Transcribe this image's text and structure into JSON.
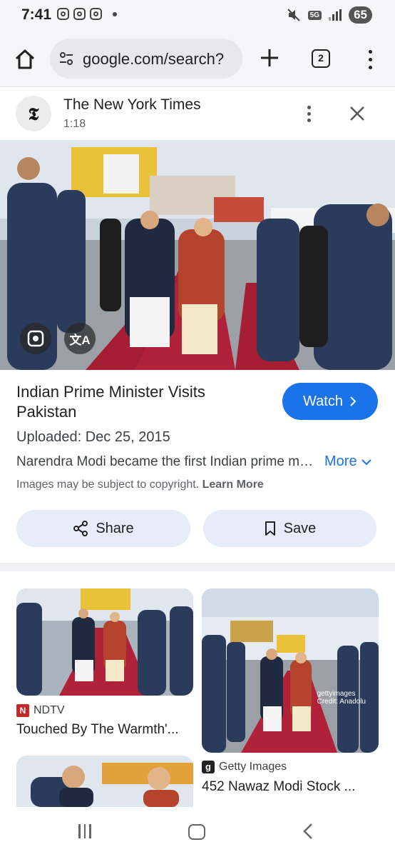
{
  "status_bar": {
    "time": "7:41",
    "network": "5G",
    "battery": "65"
  },
  "toolbar": {
    "url": "google.com/search?",
    "tab_count": "2"
  },
  "card": {
    "source_logo": "𝕿",
    "source_name": "The New York Times",
    "source_time": "1:18",
    "title": "Indian Prime Minister Visits Pakistan",
    "watch_label": "Watch",
    "uploaded": "Uploaded: Dec 25, 2015",
    "description": "Narendra Modi became the first Indian prime minister in more than a decade to visit Pakistan",
    "more_label": "More",
    "copyright_text": "Images may be subject to copyright.",
    "learn_more": "Learn More",
    "share_label": "Share",
    "save_label": "Save",
    "translate_icon_text": "文A"
  },
  "results": [
    {
      "source": "NDTV",
      "title": "Touched By The Warmth'..."
    },
    {
      "source": "Getty Images",
      "title": "452 Nawaz Modi Stock ...",
      "watermark_line1": "gettyimages",
      "watermark_line2": "Credit: Anadolu"
    }
  ],
  "icons": {
    "home": "home-icon",
    "tune": "tune-icon",
    "plus": "plus-icon",
    "menu": "more-vert-icon",
    "close": "close-icon",
    "lens": "lens-icon",
    "translate": "translate-icon",
    "share": "share-icon",
    "bookmark": "bookmark-icon",
    "chevron_right": "chevron-right-icon",
    "chevron_down": "chevron-down-icon"
  },
  "colors": {
    "accent": "#1a73e8",
    "pill_bg": "#e6edf8",
    "carpet": "#b0213a"
  }
}
